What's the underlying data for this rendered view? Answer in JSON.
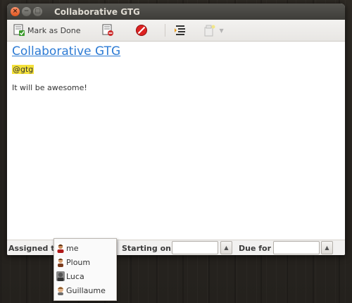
{
  "window": {
    "title": "Collaborative GTG"
  },
  "toolbar": {
    "mark_done_label": "Mark as Done",
    "icons": [
      "mark-done-icon",
      "dismiss-icon",
      "delete-icon",
      "add-subtask-icon",
      "add-tag-icon",
      "dropdown-arrow-icon"
    ]
  },
  "task": {
    "title": "Collaborative GTG",
    "tag": "@gtg",
    "body": "It will be awesome!"
  },
  "statusbar": {
    "assigned_label": "Assigned to",
    "starting_label": "Starting on",
    "starting_value": "",
    "due_label": "Due for",
    "due_value": ""
  },
  "assignee_popup": {
    "items": [
      {
        "name": "me",
        "icon": "user-me-avatar-icon"
      },
      {
        "name": "Ploum",
        "icon": "user-ploum-avatar-icon"
      },
      {
        "name": "Luca",
        "icon": "user-luca-avatar-icon"
      },
      {
        "name": "Guillaume",
        "icon": "user-guillaume-avatar-icon"
      }
    ]
  },
  "colors": {
    "title_link": "#2d7bd4",
    "tag_highlight": "#f3e03a",
    "close_button": "#e2561f"
  }
}
